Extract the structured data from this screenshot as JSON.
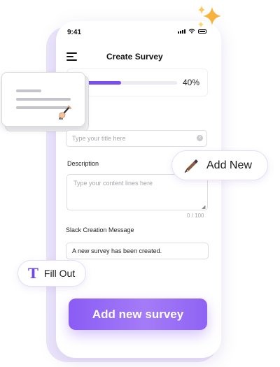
{
  "status_bar": {
    "time": "9:41",
    "icons": [
      "signal-icon",
      "wifi-icon",
      "battery-icon"
    ]
  },
  "header": {
    "title": "Create Survey",
    "menu_icon": "hamburger-menu-icon"
  },
  "progress": {
    "percent_text": "40%",
    "value": 0.4
  },
  "form": {
    "title_input": {
      "placeholder": "Type your title here",
      "value": ""
    },
    "description": {
      "label": "Description",
      "placeholder": "Type your content lines here",
      "counter": "0 / 100"
    },
    "slack_message": {
      "label": "Slack Creation Message",
      "value": "A new survey has been created."
    }
  },
  "submit_button": {
    "label": "Add new survey"
  },
  "floating_badges": {
    "add_new": {
      "label": "Add New",
      "icon": "pen-nib-icon"
    },
    "fill_out": {
      "label": "Fill Out",
      "icon": "text-t-icon"
    }
  },
  "decor": {
    "card_icon": "signing-hand-icon",
    "sparkles_icon": "sparkles-icon"
  },
  "colors": {
    "accent": "#7a4ef0",
    "sparkle": "#f7b23b",
    "phone_shadow": "#ece6fb"
  }
}
